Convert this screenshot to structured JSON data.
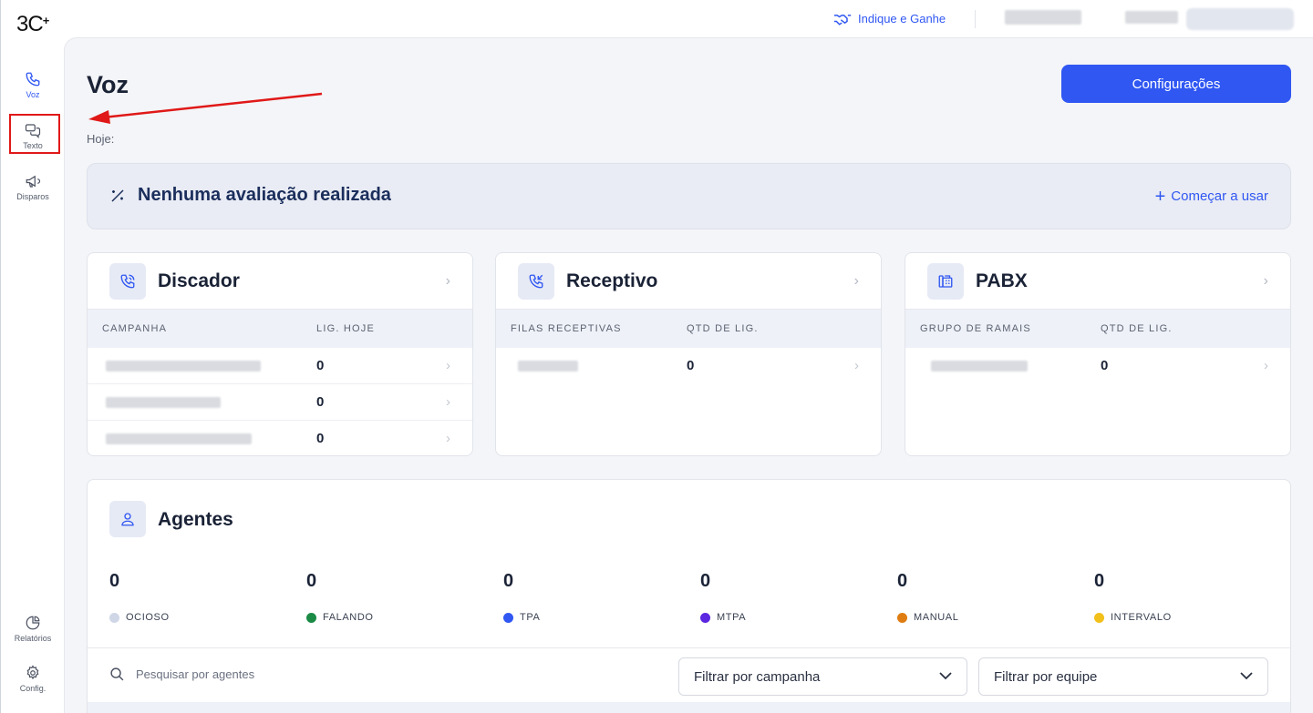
{
  "app": {
    "logo": "3C",
    "logo_plus": "+"
  },
  "sidebar": {
    "items": [
      {
        "label": "Voz",
        "icon": "phone-icon",
        "active": true
      },
      {
        "label": "Texto",
        "icon": "chat-icon",
        "active": false
      },
      {
        "label": "Disparos",
        "icon": "megaphone-icon",
        "active": false
      }
    ],
    "bottom": [
      {
        "label": "Relatórios",
        "icon": "pie-chart-icon"
      },
      {
        "label": "Config.",
        "icon": "gear-icon"
      }
    ]
  },
  "topbar": {
    "referral_label": "Indique e Ganhe"
  },
  "page": {
    "title": "Voz",
    "today_label": "Hoje:",
    "config_button": "Configurações"
  },
  "evaluation": {
    "title": "Nenhuma avaliação realizada",
    "start_label": "Começar a usar"
  },
  "cards": [
    {
      "title": "Discador",
      "col1": "CAMPANHA",
      "col2": "LIG. HOJE",
      "rows": [
        {
          "value": "0"
        },
        {
          "value": "0"
        },
        {
          "value": "0"
        }
      ]
    },
    {
      "title": "Receptivo",
      "col1": "FILAS RECEPTIVAS",
      "col2": "QTD DE LIG.",
      "rows": [
        {
          "value": "0"
        }
      ]
    },
    {
      "title": "PABX",
      "col1": "GRUPO DE RAMAIS",
      "col2": "QTD DE LIG.",
      "rows": [
        {
          "value": "0"
        }
      ]
    }
  ],
  "agents": {
    "title": "Agentes",
    "stats": [
      {
        "value": "0",
        "label": "OCIOSO",
        "color": "#cfd6e6"
      },
      {
        "value": "0",
        "label": "FALANDO",
        "color": "#1a8a45"
      },
      {
        "value": "0",
        "label": "TPA",
        "color": "#3057f2"
      },
      {
        "value": "0",
        "label": "MTPA",
        "color": "#5b27e0"
      },
      {
        "value": "0",
        "label": "MANUAL",
        "color": "#e07d12"
      },
      {
        "value": "0",
        "label": "INTERVALO",
        "color": "#f2c01a"
      }
    ],
    "search_placeholder": "Pesquisar por agentes",
    "filter_campaign": "Filtrar por campanha",
    "filter_team": "Filtrar por equipe"
  },
  "colors": {
    "accent": "#3057f2",
    "annotation": "#e01818"
  }
}
